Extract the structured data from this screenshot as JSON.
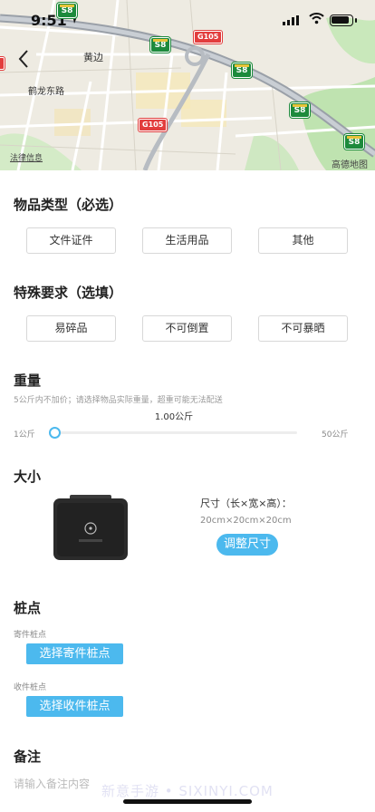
{
  "status_bar": {
    "time": "9:51"
  },
  "map": {
    "labels": {
      "huangbian": "黄边",
      "helong_east_road": "鹤龙东路"
    },
    "shields": {
      "s8": "S8",
      "g105": "G105"
    },
    "legal_info": "法律信息",
    "provider": "高德地图"
  },
  "item_type": {
    "title": "物品类型（必选）",
    "options": [
      "文件证件",
      "生活用品",
      "其他"
    ]
  },
  "special": {
    "title": "特殊要求（选填）",
    "options": [
      "易碎品",
      "不可倒置",
      "不可暴晒"
    ]
  },
  "weight": {
    "title": "重量",
    "hint": "5公斤内不加价；请选择物品实际重量，超重可能无法配送",
    "current": "1.00公斤",
    "min_label": "1公斤",
    "max_label": "50公斤",
    "min": 1,
    "max": 50,
    "value": 1
  },
  "size": {
    "title": "大小",
    "label": "尺寸（长×宽×高）：",
    "value": "20cm×20cm×20cm",
    "adjust_button": "调整尺寸"
  },
  "stake": {
    "title": "桩点",
    "send_label": "寄件桩点",
    "send_button": "选择寄件桩点",
    "receive_label": "收件桩点",
    "receive_button": "选择收件桩点"
  },
  "remark": {
    "title": "备注",
    "placeholder": "请输入备注内容"
  },
  "watermark": "新意手游 • SIXINYI.COM",
  "colors": {
    "accent": "#4cb9ee",
    "route_green": "#1d8a3c",
    "route_red": "#e23d3d"
  }
}
